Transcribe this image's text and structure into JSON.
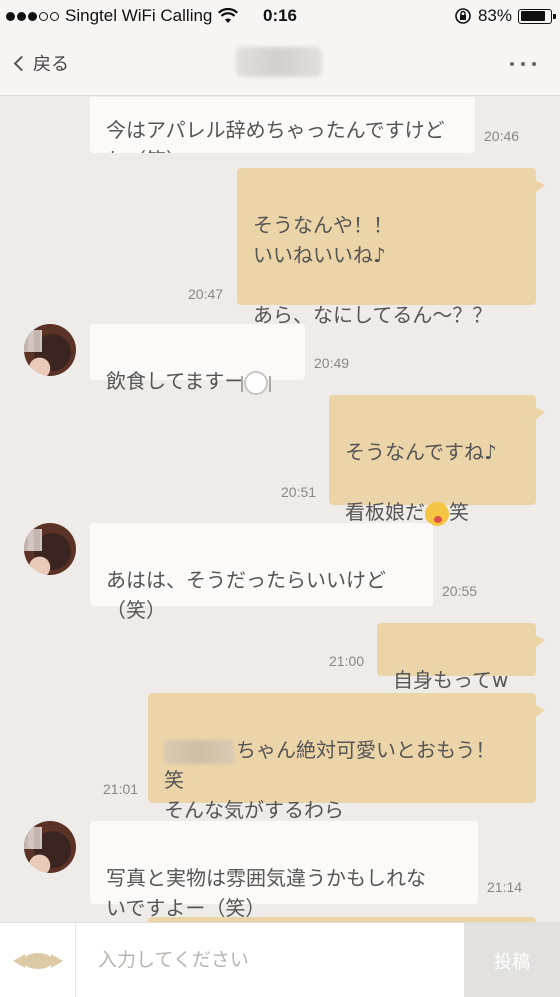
{
  "status_bar": {
    "carrier": "Singtel WiFi Calling",
    "time": "0:16",
    "battery": "83%",
    "battery_level": 0.83
  },
  "nav": {
    "back_label": "戻る"
  },
  "messages": [
    {
      "side": "in",
      "text": "今はアパレル辞めちゃったんですけどね（笑）",
      "time": "20:46"
    },
    {
      "side": "out",
      "text": "そうなんや！！\nいいねいいね♪\n\nあら、なにしてるん〜？？",
      "time": "20:47"
    },
    {
      "side": "in",
      "text": "飲食してますー",
      "time": "20:49"
    },
    {
      "side": "out",
      "text": "そうなんですね♪\n\n看板娘だ",
      "suffix": "笑",
      "time": "20:51"
    },
    {
      "side": "in",
      "text": "あはは、そうだったらいいけど\n（笑）",
      "time": "20:55"
    },
    {
      "side": "out",
      "text": "自身もってw",
      "time": "21:00"
    },
    {
      "side": "out",
      "text": "ちゃん絶対可愛いとおもう！",
      "cont": "笑\nそんな気がするわら",
      "time": "21:01"
    },
    {
      "side": "in",
      "text": "写真と実物は雰囲気違うかもしれな\nいですよー（笑）",
      "time": "21:14"
    }
  ],
  "input": {
    "placeholder": "入力してください",
    "post_label": "投稿"
  },
  "icons": {
    "sticker": "candy-icon",
    "back": "chevron-left-icon",
    "more": "more-icon"
  }
}
